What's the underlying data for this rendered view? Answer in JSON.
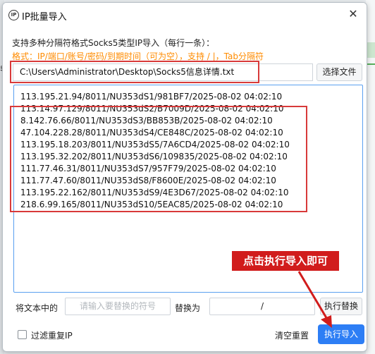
{
  "window": {
    "title": "IP批量导入",
    "app_icon_text": "IP",
    "close_glyph": "✕"
  },
  "background": {
    "left_fragment": "导"
  },
  "instructions": {
    "description": "支持多种分隔符格式Socks5类型IP导入（每行一条）：",
    "format_hint": "格式：IP/端口/账号/密码/到期时间（可为空），支持 / |，Tab分隔符",
    "format_color": "#ff8b00"
  },
  "file_select": {
    "path_value": "C:\\Users\\Administrator\\Desktop\\Socks5信息详情.txt",
    "choose_button": "选择文件"
  },
  "ip_list": [
    "113.195.21.94/8011/NU353dS1/981BF7/2025-08-02 04:02:10",
    "113.14.97.129/8011/NU353dS2/B7009D/2025-08-02 04:02:10",
    "8.142.76.66/8011/NU353dS3/BB853B/2025-08-02 04:02:10",
    "47.104.228.28/8011/NU353dS4/CE848C/2025-08-02 04:02:10",
    "113.195.18.203/8011/NU353dS5/7A6CD4/2025-08-02 04:02:10",
    "113.195.32.202/8011/NU353dS6/109835/2025-08-02 04:02:10",
    "111.77.46.31/8011/NU353dS7/957F79/2025-08-02 04:02:10",
    "111.77.47.60/8011/NU353dS8/F8600E/2025-08-02 04:02:10",
    "113.195.22.162/8011/NU353dS9/4E3D67/2025-08-02 04:02:10",
    "218.6.99.165/8011/NU353dS10/5EAC85/2025-08-02 04:02:10"
  ],
  "annotation": {
    "callout_text": "点击执行导入即可",
    "highlight_color": "#d83a3a"
  },
  "replace": {
    "find_label": "将文本中的",
    "find_placeholder": "请输入要替换的符号",
    "replace_label": "替换为",
    "replace_value": "/",
    "button": "执行替换"
  },
  "footer": {
    "filter_label": "过滤重复IP",
    "filter_checked": false,
    "clear_button": "清空重置",
    "import_button": "执行导入",
    "accent_color": "#2d7ef5"
  }
}
